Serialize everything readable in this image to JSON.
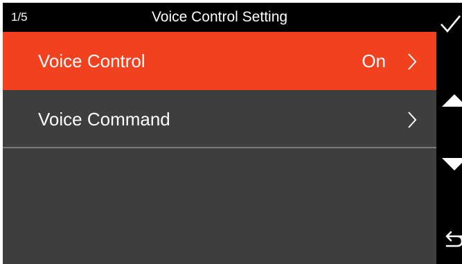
{
  "header": {
    "page_indicator": "1/5",
    "title": "Voice Control Setting"
  },
  "menu": {
    "items": [
      {
        "label": "Voice Control",
        "value": "On",
        "selected": true
      },
      {
        "label": "Voice Command",
        "value": "",
        "selected": false
      }
    ]
  },
  "side_controls": {
    "icons": [
      "check-icon",
      "arrow-up-icon",
      "arrow-down-icon",
      "back-return-icon"
    ]
  },
  "colors": {
    "accent": "#f2411f",
    "background": "#3e3e3e",
    "bar": "#000000",
    "divider": "#7a7a7a",
    "text": "#ffffff"
  }
}
